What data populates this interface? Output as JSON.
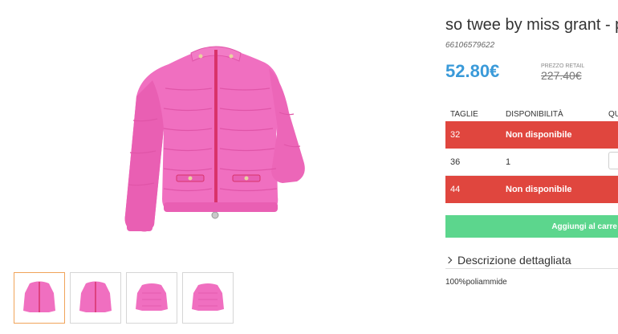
{
  "product": {
    "title": "so twee by miss grant - p",
    "sku": "66106579622",
    "price": "52.80€",
    "retail_label": "PREZZO RETAIL",
    "retail_price": "227.40€"
  },
  "sizes": {
    "headers": [
      "TAGLIE",
      "DISPONIBILITÀ",
      "QU"
    ],
    "rows": [
      {
        "size": "32",
        "availability": "Non disponibile"
      },
      {
        "size": "36",
        "availability": "1"
      },
      {
        "size": "44",
        "availability": "Non disponibile"
      }
    ]
  },
  "cart": {
    "button_label": "Aggiungi al carre"
  },
  "description": {
    "toggle_label": "Descrizione dettagliata",
    "text": "100%poliammide"
  },
  "colors": {
    "price": "#3a9ad9",
    "unavailable": "#e0463e",
    "add_to_cart": "#5cd68d",
    "jacket": "#f06fc0",
    "zipper": "#d8336a"
  },
  "thumbnails": [
    {
      "icon": "jacket-front-thumbnail",
      "active": true
    },
    {
      "icon": "jacket-front-thumbnail",
      "active": false
    },
    {
      "icon": "jacket-back-thumbnail",
      "active": false
    },
    {
      "icon": "jacket-back-thumbnail",
      "active": false
    }
  ]
}
